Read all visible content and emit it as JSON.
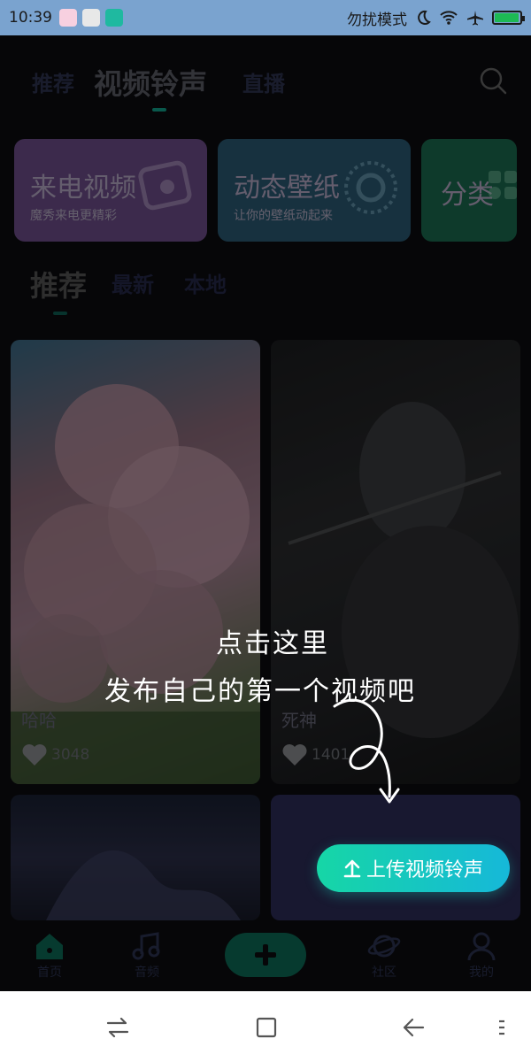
{
  "status_bar": {
    "time": "10:39",
    "dnd_label": "勿扰模式",
    "battery_level": 0.95
  },
  "top_tabs": {
    "items": [
      {
        "label": "推荐"
      },
      {
        "label": "视频铃声"
      },
      {
        "label": "直播"
      }
    ],
    "active_index": 1,
    "search_icon": "search-icon"
  },
  "categories": [
    {
      "title": "来电视频",
      "subtitle": "魔秀来电更精彩",
      "color": "#6e4d8a"
    },
    {
      "title": "动态壁纸",
      "subtitle": "让你的壁纸动起来",
      "color": "#2a5a73"
    },
    {
      "title": "分类",
      "subtitle": "",
      "color": "#1a6b4f"
    }
  ],
  "sub_tabs": {
    "items": [
      {
        "label": "推荐"
      },
      {
        "label": "最新"
      },
      {
        "label": "本地"
      }
    ],
    "active_index": 0
  },
  "videos": [
    {
      "title": "哈哈",
      "likes": "3048"
    },
    {
      "title": "死神",
      "likes": "1401"
    },
    {
      "title": "",
      "likes": ""
    },
    {
      "title": "",
      "likes": ""
    }
  ],
  "guide": {
    "line1": "点击这里",
    "line2": "发布自己的第一个视频吧",
    "upload_label": "上传视频铃声"
  },
  "bottom_nav": [
    {
      "label": "首页",
      "icon": "home-icon"
    },
    {
      "label": "音频",
      "icon": "music-icon"
    },
    {
      "label": "",
      "icon": "plus-icon"
    },
    {
      "label": "社区",
      "icon": "planet-icon"
    },
    {
      "label": "我的",
      "icon": "profile-icon"
    }
  ]
}
